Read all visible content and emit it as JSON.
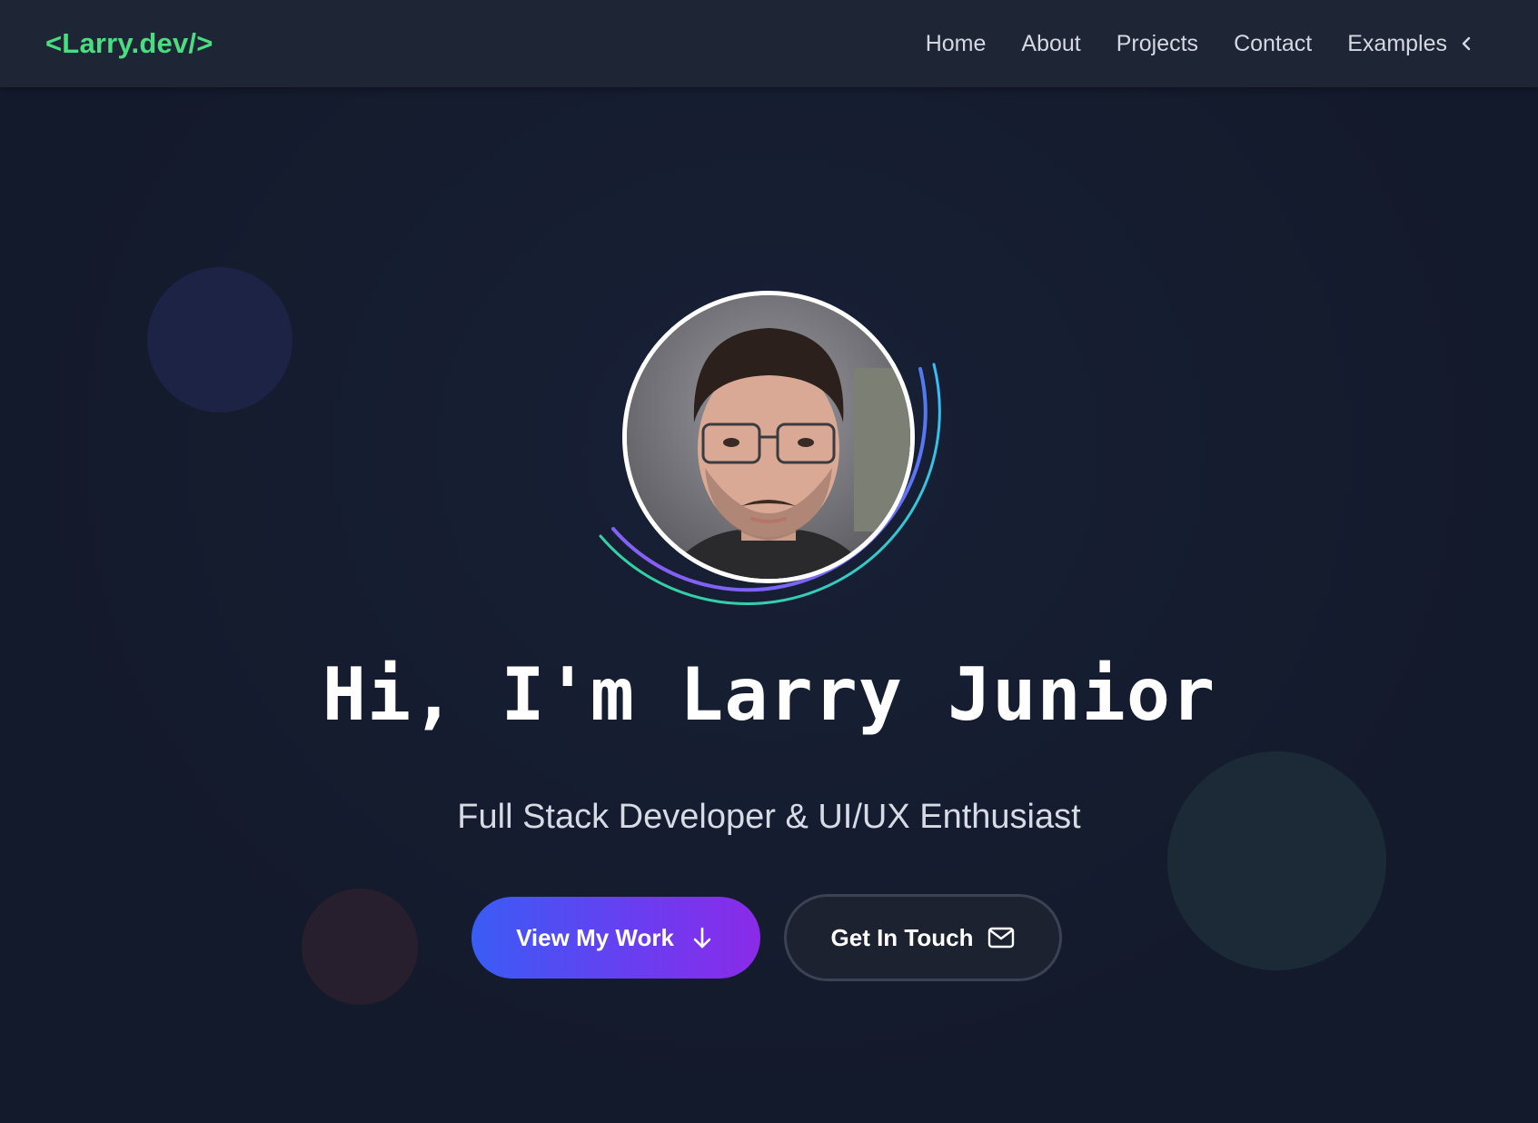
{
  "nav": {
    "logo": "<Larry.dev/>",
    "links": [
      "Home",
      "About",
      "Projects",
      "Contact"
    ],
    "dropdown_label": "Examples"
  },
  "hero": {
    "headline": "Hi, I'm Larry Junior",
    "subtitle": "Full Stack Developer & UI/UX Enthusiast",
    "primary_button": "View My Work",
    "secondary_button": "Get In Touch"
  },
  "icons": {
    "dropdown": "chevron-left-icon",
    "primary_button": "arrow-down-icon",
    "secondary_button": "mail-icon"
  },
  "colors": {
    "background": "#141b2d",
    "navbar": "#1e2535",
    "logo": "#4ade80",
    "primary_gradient_start": "#3a5cf5",
    "primary_gradient_end": "#8a2be8",
    "ring_blue": "#4f7cf0",
    "ring_purple": "#8b5cf6",
    "ring_green": "#34d399",
    "ring_cyan": "#38bdf8"
  }
}
